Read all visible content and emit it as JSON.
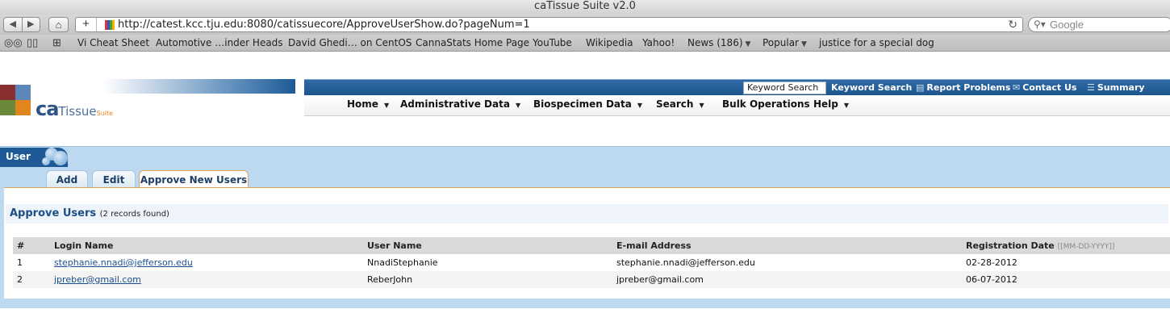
{
  "window": {
    "title": "caTissue Suite v2.0"
  },
  "browser": {
    "url": "http://catest.kcc.tju.edu:8080/catissuecore/ApproveUserShow.do?pageNum=1",
    "search_placeholder": "Google",
    "bookmarks": [
      {
        "label": "Vi Cheat Sheet",
        "menu": false
      },
      {
        "label": "Automotive …inder Heads",
        "menu": false
      },
      {
        "label": "David Ghedi… on CentOS",
        "menu": false
      },
      {
        "label": "CannaStats Home Page",
        "menu": false
      },
      {
        "label": "YouTube",
        "menu": false
      },
      {
        "label": "Wikipedia",
        "menu": false
      },
      {
        "label": "Yahoo!",
        "menu": false
      },
      {
        "label": "News (186)",
        "menu": true
      },
      {
        "label": "Popular",
        "menu": true
      },
      {
        "label": "justice for a special dog",
        "menu": false
      }
    ]
  },
  "logo": {
    "ca": "ca",
    "tissue": "Tissue",
    "suite": "Suite"
  },
  "header": {
    "keyword_value": "Keyword Search",
    "links": {
      "keyword_search": "Keyword Search",
      "report_problems": "Report Problems",
      "contact_us": "Contact Us",
      "summary": "Summary"
    },
    "menus": {
      "home": "Home",
      "administrative_data": "Administrative Data",
      "biospecimen_data": "Biospecimen Data",
      "search": "Search",
      "bulk_operations": "Bulk Operations",
      "help": "Help"
    }
  },
  "section": {
    "label": "User",
    "tabs": {
      "add": "Add",
      "edit": "Edit",
      "approve": "Approve New Users"
    }
  },
  "approve": {
    "title": "Approve Users",
    "count": "(2 records found)",
    "columns": {
      "num": "#",
      "login": "Login Name",
      "user": "User Name",
      "email": "E-mail Address",
      "reg_date": "Registration Date",
      "reg_date_format": "[[MM-DD-YYYY]]"
    },
    "rows": [
      {
        "num": "1",
        "login": "stephanie.nnadi@jefferson.edu",
        "user": "NnadiStephanie",
        "email": "stephanie.nnadi@jefferson.edu",
        "date": "02-28-2012"
      },
      {
        "num": "2",
        "login": "jpreber@gmail.com",
        "user": "ReberJohn",
        "email": "jpreber@gmail.com",
        "date": "06-07-2012"
      }
    ]
  },
  "colors": {
    "brand_blue": "#1d5a96",
    "band_blue": "#bcd9ef",
    "tab_orange": "#e3a15a",
    "link_blue": "#1a4f8f"
  }
}
